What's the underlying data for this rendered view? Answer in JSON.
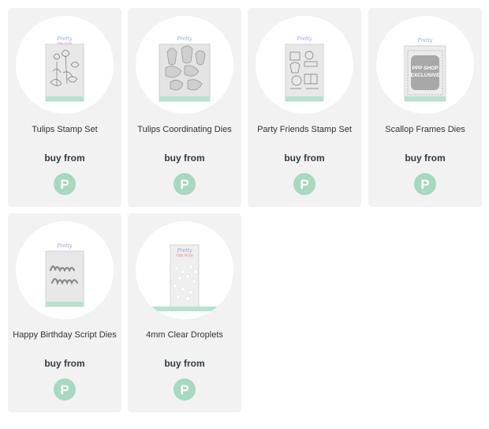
{
  "colors": {
    "card_bg": "#f2f2f2",
    "shop_button": "#a6d9bf",
    "label_band": "#b5e3cb"
  },
  "products": [
    {
      "name": "Tulips Stamp Set",
      "buy_label": "buy from",
      "shop_icon": "pretty-pink-posh-p-icon",
      "shop_glyph": "P"
    },
    {
      "name": "Tulips Coordinating Dies",
      "buy_label": "buy from",
      "shop_icon": "pretty-pink-posh-p-icon",
      "shop_glyph": "P"
    },
    {
      "name": "Party Friends Stamp Set",
      "buy_label": "buy from",
      "shop_icon": "pretty-pink-posh-p-icon",
      "shop_glyph": "P"
    },
    {
      "name": "Scallop Frames Dies",
      "buy_label": "buy from",
      "shop_icon": "pretty-pink-posh-p-icon",
      "shop_glyph": "P",
      "package_text": "PPP SHOP EXCLUSIVE"
    },
    {
      "name": "Happy Birthday Script Dies",
      "buy_label": "buy from",
      "shop_icon": "pretty-pink-posh-p-icon",
      "shop_glyph": "P"
    },
    {
      "name": "4mm Clear Droplets",
      "buy_label": "buy from",
      "shop_icon": "pretty-pink-posh-p-icon",
      "shop_glyph": "P"
    }
  ]
}
